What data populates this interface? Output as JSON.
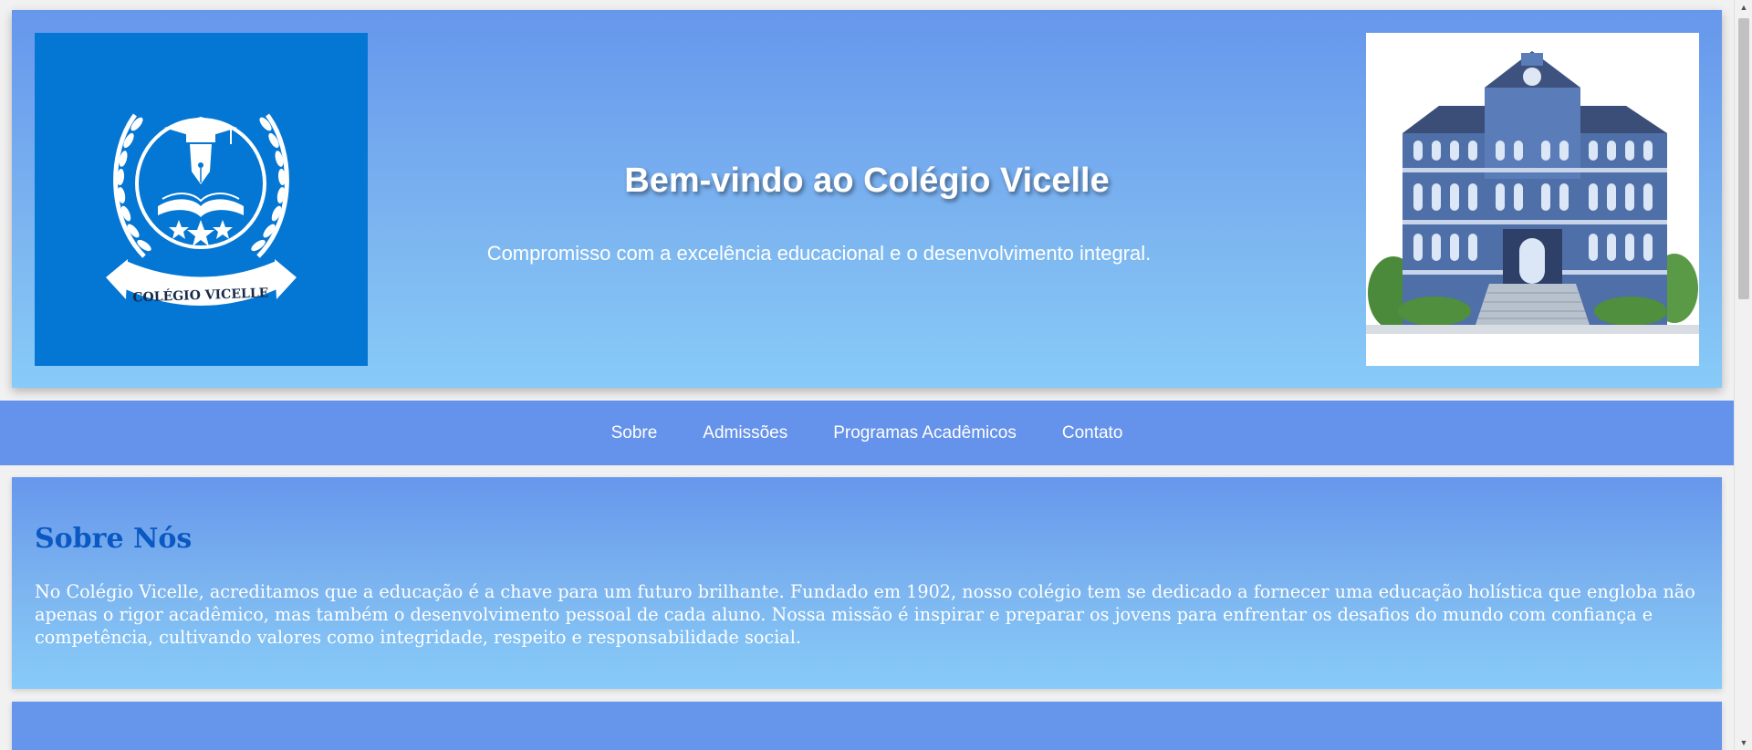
{
  "header": {
    "title": "Bem-vindo ao Colégio Vicelle",
    "subtitle": "Compromisso com a excelência educacional e o desenvolvimento integral.",
    "logo_text": "COLÉGIO VICELLE",
    "logo_icon": "school-crest-icon",
    "building_image": "school-building-illustration"
  },
  "nav": {
    "items": [
      "Sobre",
      "Admissões",
      "Programas Acadêmicos",
      "Contato"
    ]
  },
  "about": {
    "heading": "Sobre Nós",
    "text": "No Colégio Vicelle, acreditamos que a educação é a chave para um futuro brilhante. Fundado em 1902, nosso colégio tem se dedicado a fornecer uma educação holística que engloba não apenas o rigor acadêmico, mas também o desenvolvimento pessoal de cada aluno. Nossa missão é inspirar e preparar os jovens para enfrentar os desafios do mundo com confiança e competência, cultivando valores como integridade, respeito e responsabilidade social."
  },
  "colors": {
    "header_gradient_top": "#6697ec",
    "header_gradient_bottom": "#87cbf8",
    "nav_bg": "#6592ea",
    "logo_bg": "#0476d3",
    "heading_color": "#0a58c2"
  }
}
